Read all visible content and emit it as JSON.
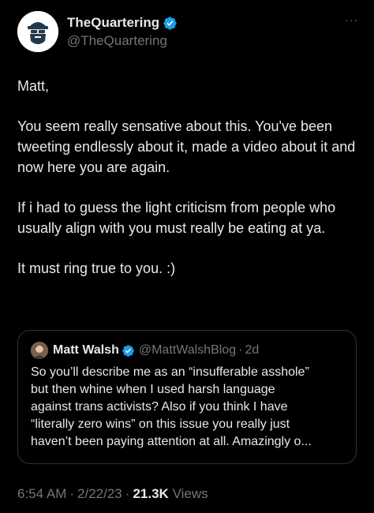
{
  "tweet": {
    "author": {
      "display_name": "TheQuartering",
      "handle": "@TheQuartering",
      "verified": true,
      "avatar_icon": "bearded-man-avatar"
    },
    "more_label": "···",
    "paragraphs": [
      "Matt,",
      "You seem really sensative about this. You've been tweeting endlessly about it, made a video about it and now here you are again.",
      "If i had to guess the light criticism from people who usually align with you must really be eating at ya.",
      "It must ring true to you. :)"
    ],
    "quoted_tweet": {
      "display_name": "Matt Walsh",
      "handle": "@MattWalshBlog",
      "separator": "·",
      "time_ago": "2d",
      "verified": true,
      "text_lines": [
        "So you’ll describe me as an “insufferable asshole”",
        "but then whine when I used harsh language",
        "against trans activists? Also if you think I have",
        "“literally zero wins” on this issue you really just",
        "haven’t been paying attention at all. Amazingly o..."
      ]
    },
    "meta": {
      "time": "6:54 AM",
      "separator": "·",
      "date": "2/22/23",
      "views_count": "21.3K",
      "views_label": "Views"
    }
  },
  "colors": {
    "background": "#000000",
    "text_primary": "#e7e9ea",
    "text_secondary": "#71767b",
    "verified_blue": "#1d9bf0",
    "border": "#2f3336"
  }
}
